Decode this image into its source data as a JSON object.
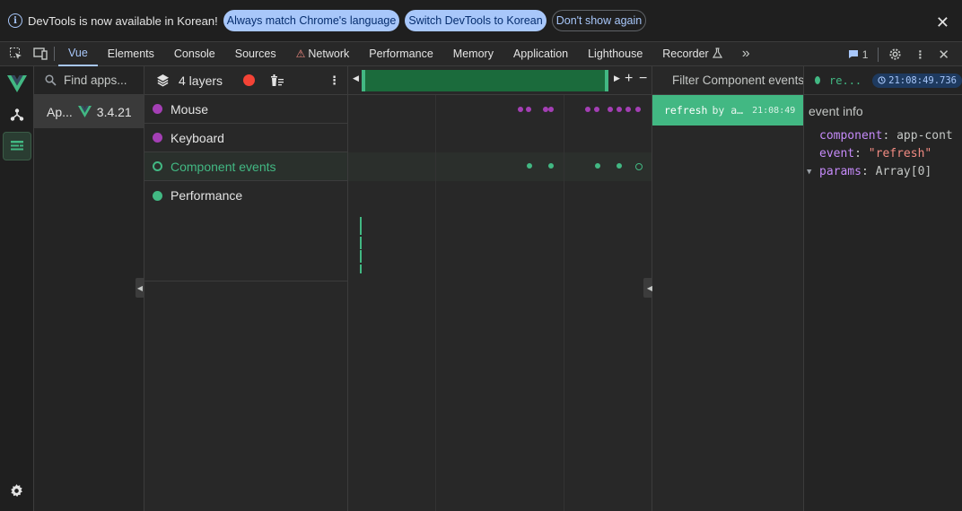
{
  "infobar": {
    "message": "DevTools is now available in Korean!",
    "btn_match": "Always match Chrome's language",
    "btn_switch": "Switch DevTools to Korean",
    "btn_dont_show": "Don't show again"
  },
  "tabs": [
    {
      "label": "Vue",
      "active": true
    },
    {
      "label": "Elements"
    },
    {
      "label": "Console"
    },
    {
      "label": "Sources"
    },
    {
      "label": "Network",
      "warning": true
    },
    {
      "label": "Performance"
    },
    {
      "label": "Memory"
    },
    {
      "label": "Application"
    },
    {
      "label": "Lighthouse"
    },
    {
      "label": "Recorder"
    }
  ],
  "toolbar": {
    "more_tabs": "»",
    "issues_count": "1"
  },
  "apps": {
    "search_placeholder": "Find apps...",
    "selected_app_name": "Ap...",
    "selected_app_version": "3.4.21"
  },
  "layers": {
    "title": "4 layers",
    "items": [
      {
        "label": "Mouse",
        "color": "#a43fb5"
      },
      {
        "label": "Keyboard",
        "color": "#a43fb5"
      },
      {
        "label": "Component events",
        "color": "#42b883",
        "active": true
      },
      {
        "label": "Performance",
        "color": "#42b883"
      }
    ]
  },
  "timeline": {
    "zoom_in": "+",
    "zoom_out": "−"
  },
  "events": {
    "filter_placeholder": "Filter Component events",
    "selected": {
      "name": "refresh",
      "by_label": "by a…",
      "time": "21:08:49"
    }
  },
  "inspector": {
    "event_name": "re...",
    "timestamp": "21:08:49.736",
    "section_title": "event info",
    "props": {
      "component_key": "component",
      "component_value": "app-cont",
      "event_key": "event",
      "event_value": "\"refresh\"",
      "params_key": "params",
      "params_value": "Array[0]"
    }
  },
  "colors": {
    "accent": "#42b883",
    "mouse_layer": "#a43fb5",
    "recording": "#f44336",
    "link": "#a8c7fa"
  }
}
